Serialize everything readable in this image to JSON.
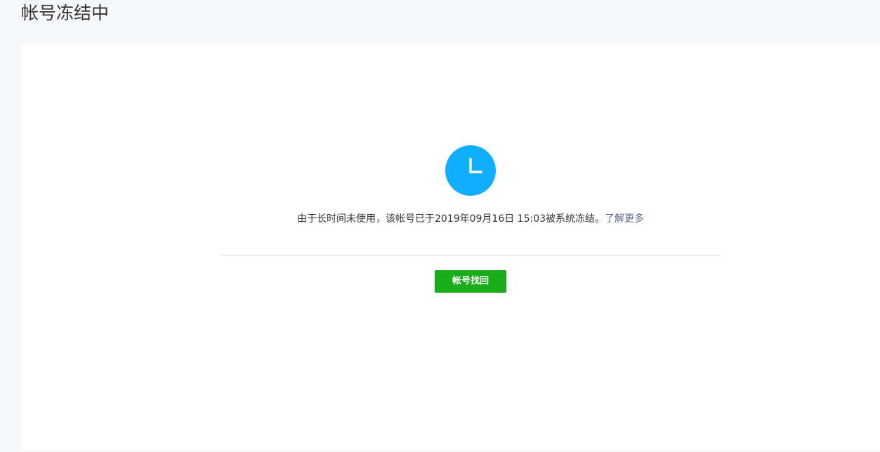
{
  "page": {
    "title": "帐号冻结中"
  },
  "notice": {
    "icon": "clock-icon",
    "icon_color": "#10aeff",
    "message": "由于长时间未使用，该帐号已于2019年09月16日 15:03被系统冻结。",
    "learn_more_label": "了解更多",
    "link_color": "#576b95"
  },
  "actions": {
    "recover_label": "帐号找回",
    "recover_color": "#1aad19"
  }
}
